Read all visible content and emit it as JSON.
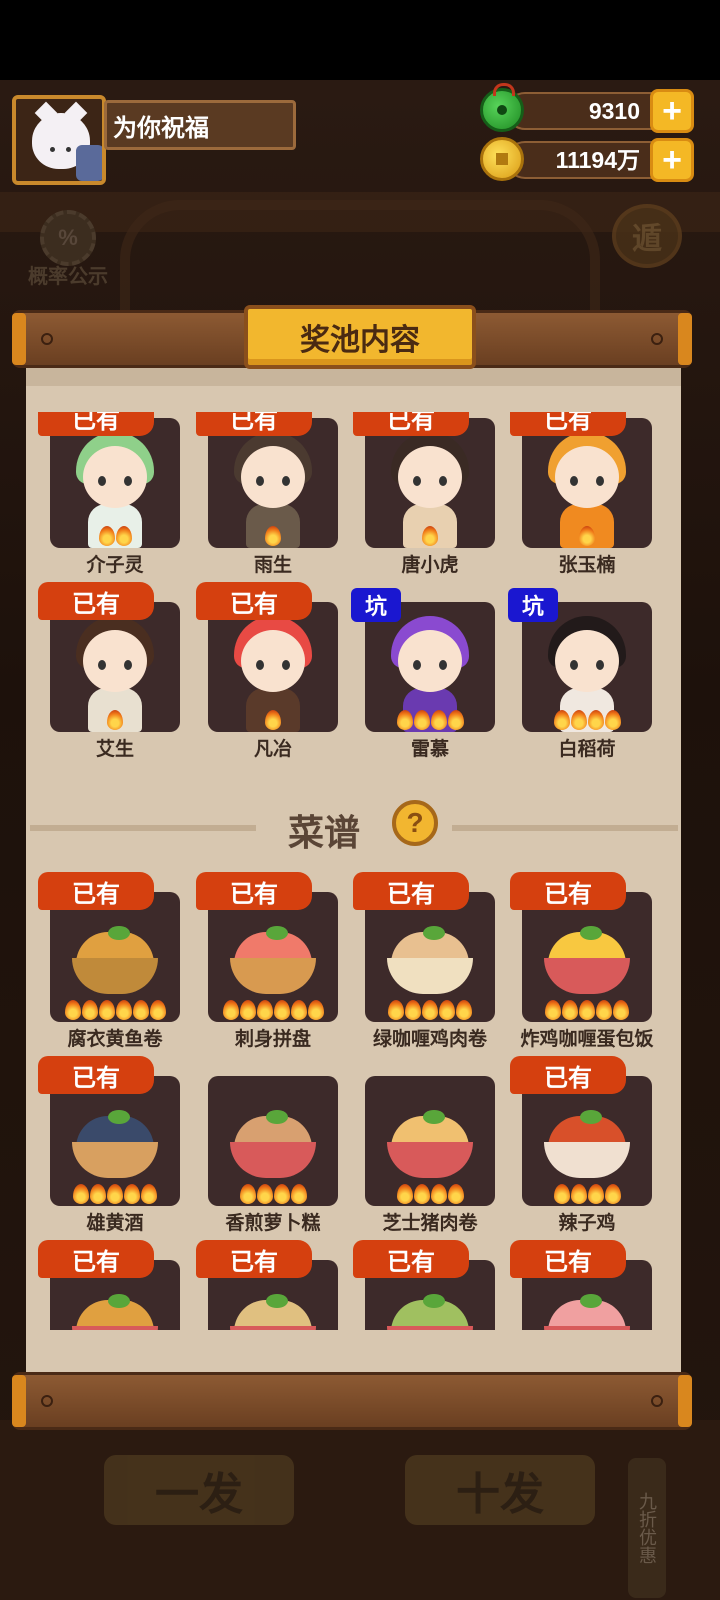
{
  "player": {
    "name": "为你祝福"
  },
  "currency": {
    "jade": "9310",
    "gold": "11194万"
  },
  "side": {
    "probability_label": "概率公示",
    "probability_symbol": "%",
    "right_badge": "遁"
  },
  "bottom": {
    "single_draw": "一发",
    "ten_draw": "十发",
    "discount": "九折优惠"
  },
  "panel": {
    "title": "奖池内容",
    "characters": [
      {
        "name": "介子灵",
        "badge": "已有",
        "flames": 2,
        "hair": "#8fd08a",
        "body": "#e8f0e8"
      },
      {
        "name": "雨生",
        "badge": "已有",
        "flames": 1,
        "hair": "#4b3a30",
        "body": "#6a5a4a"
      },
      {
        "name": "唐小虎",
        "badge": "已有",
        "flames": 1,
        "hair": "#3a2a24",
        "body": "#e8d0b0"
      },
      {
        "name": "张玉楠",
        "badge": "已有",
        "flames": 1,
        "hair": "#f0a030",
        "body": "#f08a20"
      },
      {
        "name": "艾生",
        "badge": "已有",
        "flames": 1,
        "hair": "#4a2e20",
        "body": "#e8e0d0"
      },
      {
        "name": "凡冶",
        "badge": "已有",
        "flames": 1,
        "hair": "#e84a44",
        "body": "#5a3a2a"
      },
      {
        "name": "雷慕",
        "badge": "坑",
        "flames": 4,
        "hair": "#8a4ad0",
        "body": "#6a3ab0"
      },
      {
        "name": "白稻荷",
        "badge": "坑",
        "flames": 4,
        "hair": "#221a1a",
        "body": "#f0e8e0"
      }
    ],
    "recipes_title": "菜谱",
    "recipes_help": "?",
    "recipes": [
      {
        "name": "腐衣黄鱼卷",
        "badge": "已有",
        "flames": 6,
        "food": "#e0a040",
        "bowl": "#c08a3a"
      },
      {
        "name": "刺身拼盘",
        "badge": "已有",
        "flames": 6,
        "food": "#f07a6a",
        "bowl": "#d89a50"
      },
      {
        "name": "绿咖喱鸡肉卷",
        "badge": "已有",
        "flames": 5,
        "food": "#e8c090",
        "bowl": "#f0e0c0"
      },
      {
        "name": "炸鸡咖喱蛋包饭",
        "badge": "已有",
        "flames": 5,
        "food": "#f8c840",
        "bowl": "#d85a5a"
      },
      {
        "name": "雄黄酒",
        "badge": "已有",
        "flames": 5,
        "food": "#3a4a6a",
        "bowl": "#d8a060"
      },
      {
        "name": "香煎萝卜糕",
        "badge": "",
        "flames": 4,
        "food": "#d8a070",
        "bowl": "#d85a5a"
      },
      {
        "name": "芝士猪肉卷",
        "badge": "",
        "flames": 4,
        "food": "#f0c070",
        "bowl": "#d85a5a"
      },
      {
        "name": "辣子鸡",
        "badge": "已有",
        "flames": 4,
        "food": "#d8502a",
        "bowl": "#f0e0d0"
      },
      {
        "name": "",
        "badge": "已有",
        "flames": 0,
        "food": "#e0a040",
        "bowl": "#d85a5a"
      },
      {
        "name": "",
        "badge": "已有",
        "flames": 0,
        "food": "#e0c080",
        "bowl": "#d85a5a"
      },
      {
        "name": "",
        "badge": "已有",
        "flames": 0,
        "food": "#a0c060",
        "bowl": "#d85a5a"
      },
      {
        "name": "",
        "badge": "已有",
        "flames": 0,
        "food": "#f0a0a0",
        "bowl": "#d85a5a"
      }
    ]
  },
  "colors": {
    "owned_badge": "#d5400f",
    "pit_badge": "#1a17d0",
    "paper": "#d8c7b0",
    "plaque": "#f2b72e"
  }
}
